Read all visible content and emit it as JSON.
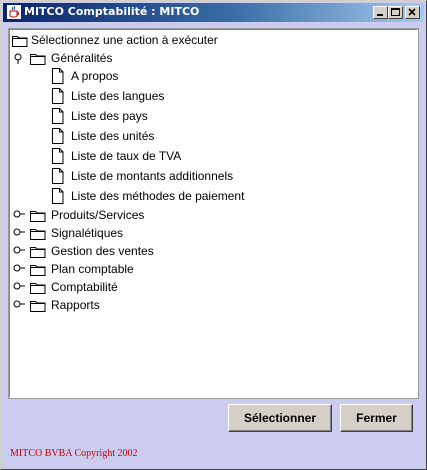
{
  "window": {
    "title": "MITCO Comptabilité : MITCO",
    "icon": "java-cup-icon",
    "controls": [
      "minimize-icon",
      "maximize-icon",
      "close-icon"
    ]
  },
  "tree": {
    "root": {
      "label": "Sélectionnez une action à exécuter",
      "icon": "folder-icon"
    },
    "groups": [
      {
        "label": "Généralités",
        "expanded": true,
        "children": [
          "A propos",
          "Liste des langues",
          "Liste des pays",
          "Liste des unités",
          "Liste de taux de TVA",
          "Liste de montants additionnels",
          "Liste des méthodes de paiement"
        ]
      },
      {
        "label": "Produits/Services",
        "expanded": false
      },
      {
        "label": "Signalétiques",
        "expanded": false
      },
      {
        "label": "Gestion des ventes",
        "expanded": false
      },
      {
        "label": "Plan comptable",
        "expanded": false
      },
      {
        "label": "Comptabilité",
        "expanded": false
      },
      {
        "label": "Rapports",
        "expanded": false
      }
    ]
  },
  "buttons": {
    "select_label": "Sélectionner",
    "close_label": "Fermer"
  },
  "footer": {
    "copyright": "MITCO BVBA Copyright 2002"
  },
  "colors": {
    "window_bg": "#ccccf0",
    "title_gradient_start": "#0a246a",
    "title_gradient_end": "#a6caf0",
    "copyright_text": "#cc0000",
    "button_face": "#d4d0c8"
  }
}
